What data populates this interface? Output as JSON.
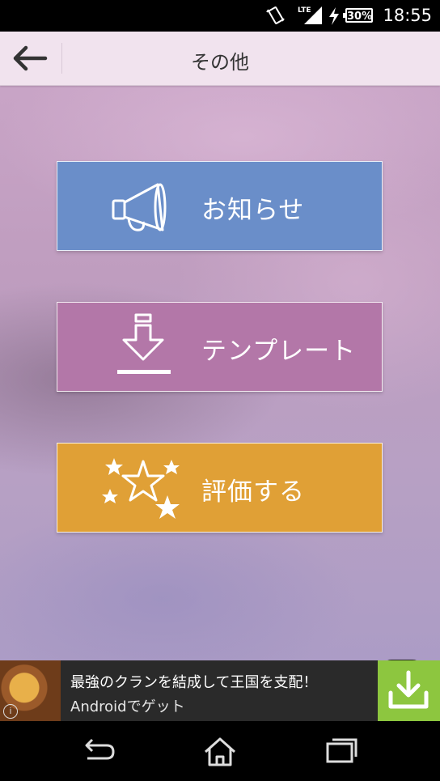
{
  "status_bar": {
    "battery": "30%",
    "time": "18:55",
    "network": "LTE"
  },
  "header": {
    "title": "その他",
    "back_icon": "arrow-left-icon"
  },
  "menu": [
    {
      "label": "お知らせ",
      "icon": "megaphone-icon",
      "color": "#6a8ec9"
    },
    {
      "label": "テンプレート",
      "icon": "download-icon",
      "color": "#b377a8"
    },
    {
      "label": "評価する",
      "icon": "stars-icon",
      "color": "#e0a036"
    }
  ],
  "ad": {
    "line1": "最強のクランを結成して王国を支配！",
    "line2": "Androidでゲット",
    "info": "i",
    "download_color": "#8dc63f"
  },
  "navbar": {
    "icons": [
      "back-icon",
      "home-icon",
      "recent-apps-icon"
    ]
  }
}
